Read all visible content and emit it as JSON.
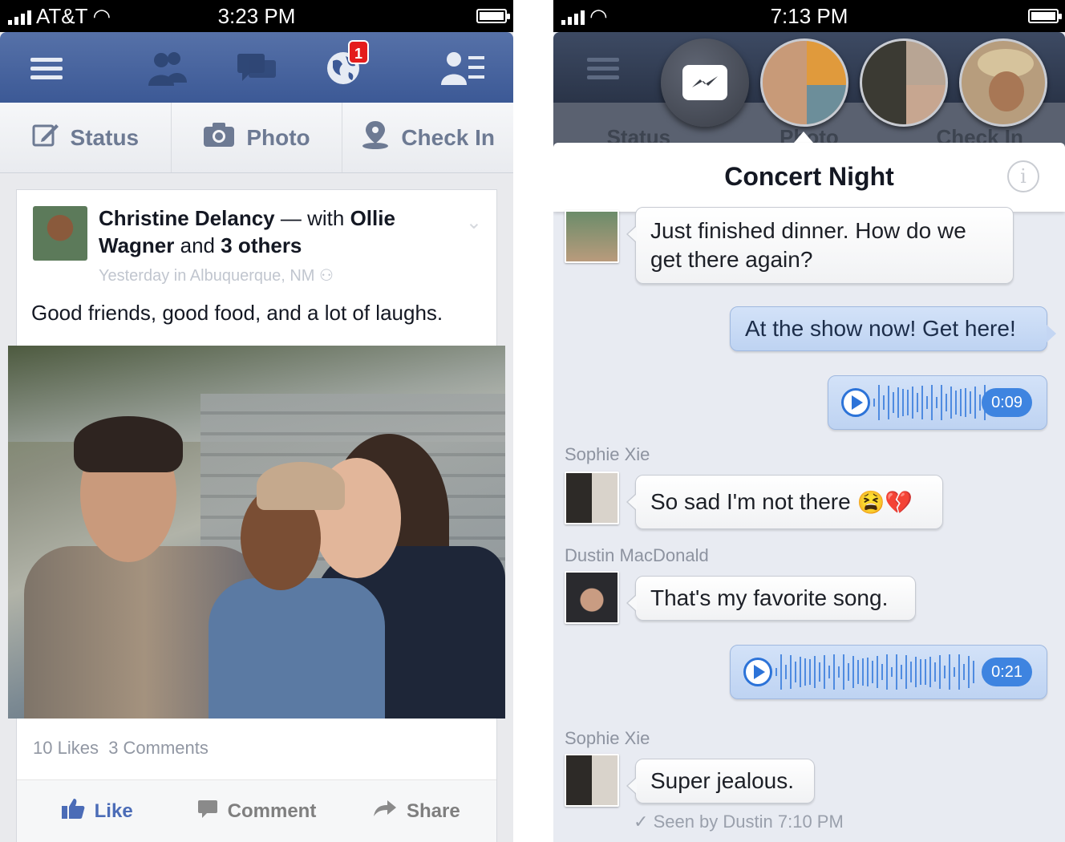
{
  "left": {
    "status": {
      "carrier": "AT&T",
      "time": "3:23 PM"
    },
    "nav": {
      "notifications_badge": "1"
    },
    "composer": {
      "status": "Status",
      "photo": "Photo",
      "checkin": "Check In"
    },
    "post": {
      "author": "Christine Delancy",
      "with_text": "— with",
      "tagged_1": "Ollie Wagner",
      "and_text": "and",
      "tagged_more": "3 others",
      "meta": "Yesterday in Albuquerque, NM",
      "text": "Good friends, good food, and a lot of laughs.",
      "likes": "10 Likes",
      "comments": "3 Comments",
      "actions": {
        "like": "Like",
        "comment": "Comment",
        "share": "Share"
      }
    }
  },
  "right": {
    "status": {
      "time": "7:13 PM"
    },
    "composer": {
      "status": "Status",
      "photo": "Photo",
      "checkin": "Check In"
    },
    "conversation": {
      "title": "Concert Night",
      "messages": [
        {
          "text": "Just finished dinner. How do we get there again?"
        },
        {
          "text": "At the show now! Get here!"
        },
        {
          "duration": "0:09"
        },
        {
          "sender": "Sophie Xie",
          "text": "So sad I'm not there",
          "emoji": "😫💔"
        },
        {
          "sender": "Dustin MacDonald",
          "text": "That's my favorite song."
        },
        {
          "duration": "0:21"
        },
        {
          "sender": "Sophie Xie",
          "text": "Super jealous."
        }
      ],
      "seen": "Seen by Dustin 7:10 PM"
    }
  }
}
